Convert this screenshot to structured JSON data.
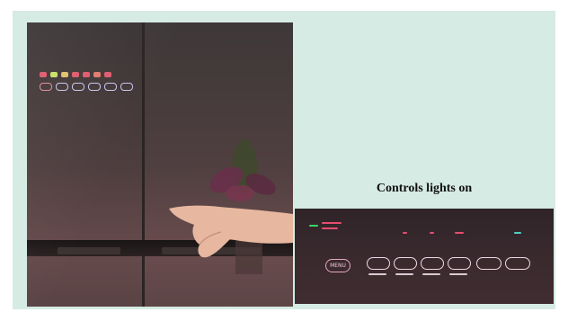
{
  "caption": "Controls lights on",
  "control_panel": {
    "menu_label": "MENU",
    "buttons": [
      "",
      "",
      "",
      "",
      "",
      ""
    ]
  },
  "colors": {
    "background": "#d6ebe3",
    "panel_bg": "#2f2428",
    "indicator_green": "#39d46a",
    "indicator_red": "#e84d70",
    "indicator_teal": "#4fd1c0",
    "button_outline": "#f0d8e6"
  }
}
